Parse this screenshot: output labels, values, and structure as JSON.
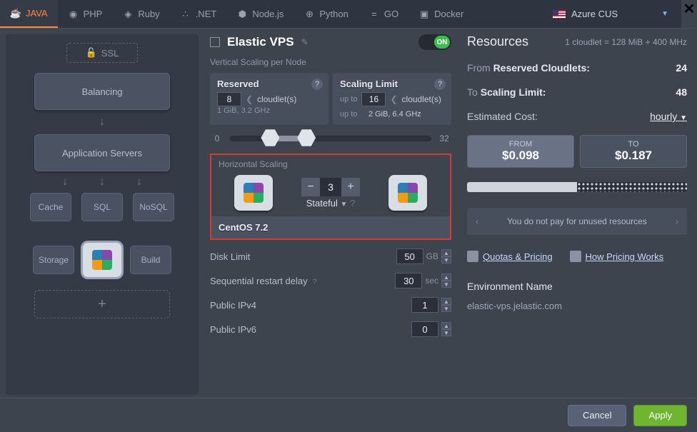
{
  "tabs": {
    "java": "JAVA",
    "php": "PHP",
    "ruby": "Ruby",
    "dotnet": ".NET",
    "nodejs": "Node.js",
    "python": "Python",
    "go": "GO",
    "docker": "Docker"
  },
  "region": {
    "name": "Azure CUS"
  },
  "left": {
    "ssl": "SSL",
    "balancing": "Balancing",
    "appservers": "Application Servers",
    "cache": "Cache",
    "sql": "SQL",
    "nosql": "NoSQL",
    "storage": "Storage",
    "build": "Build",
    "plus": "+"
  },
  "mid": {
    "title": "Elastic VPS",
    "toggle": "ON",
    "vertical_label": "Vertical Scaling per Node",
    "reserved": {
      "title": "Reserved",
      "value": "8",
      "unit": "cloudlet(s)",
      "desc": "1 GiB, 3.2 GHz"
    },
    "limit": {
      "title": "Scaling Limit",
      "prefix": "up to",
      "value": "16",
      "unit": "cloudlet(s)",
      "desc_prefix": "up to",
      "desc": "2 GiB, 6.4 GHz"
    },
    "slider": {
      "min": "0",
      "max": "32"
    },
    "hs_label": "Horizontal Scaling",
    "hs_count": "3",
    "stateful": "Stateful",
    "os": "CentOS 7.2",
    "disk": {
      "label": "Disk Limit",
      "value": "50",
      "unit": "GB"
    },
    "restart": {
      "label": "Sequential restart delay",
      "value": "30",
      "unit": "sec"
    },
    "ipv4": {
      "label": "Public IPv4",
      "value": "1"
    },
    "ipv6": {
      "label": "Public IPv6",
      "value": "0"
    }
  },
  "right": {
    "title": "Resources",
    "cloudlet_eq": "1 cloudlet = 128 MiB + 400 MHz",
    "from_label": "From",
    "from_text": "Reserved Cloudlets:",
    "from_val": "24",
    "to_label": "To",
    "to_text": "Scaling Limit:",
    "to_val": "48",
    "est_label": "Estimated Cost:",
    "period": "hourly",
    "from_box_t": "FROM",
    "from_box_p": "$0.098",
    "to_box_t": "TO",
    "to_box_p": "$0.187",
    "info": "You do not pay for unused resources",
    "link_quotas": "Quotas & Pricing",
    "link_pricing": "How Pricing Works",
    "env_label": "Environment Name",
    "env_value": "elastic-vps.jelastic.com"
  },
  "footer": {
    "cancel": "Cancel",
    "apply": "Apply"
  }
}
